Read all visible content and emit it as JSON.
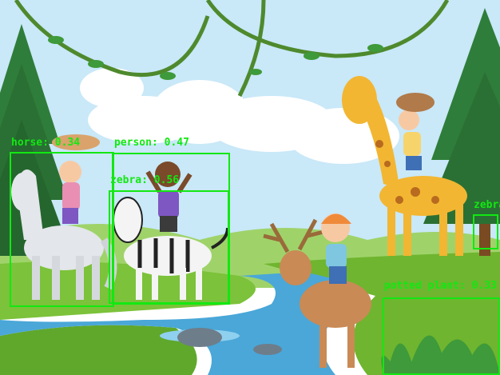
{
  "detections": [
    {
      "label": "horse: 0.34"
    },
    {
      "label": "person: 0.47"
    },
    {
      "label": "zebra: 0.56"
    },
    {
      "label": "zebra"
    },
    {
      "label": "potted plant: 0.33"
    }
  ],
  "colors": {
    "box": "#12e812",
    "sky": "#bfe3f6",
    "grass": "#7cc23a",
    "river": "#4aa7d8",
    "tree": "#2f7d3a"
  }
}
